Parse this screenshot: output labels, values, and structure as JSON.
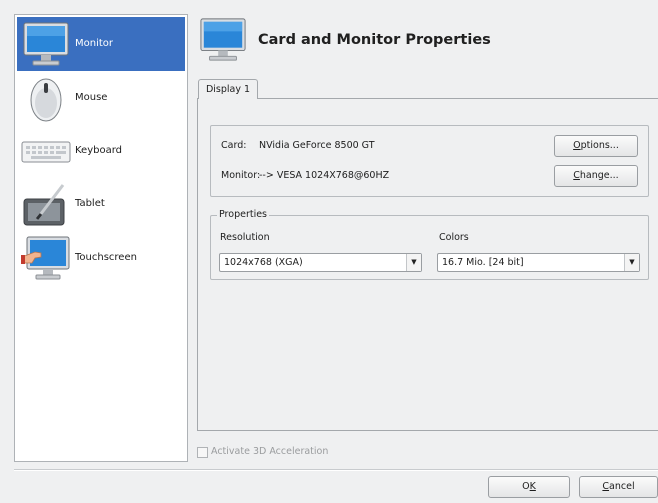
{
  "sidebar": {
    "items": [
      {
        "label": "Monitor",
        "icon": "monitor-icon",
        "selected": true
      },
      {
        "label": "Mouse",
        "icon": "mouse-icon",
        "selected": false
      },
      {
        "label": "Keyboard",
        "icon": "keyboard-icon",
        "selected": false
      },
      {
        "label": "Tablet",
        "icon": "tablet-icon",
        "selected": false
      },
      {
        "label": "Touchscreen",
        "icon": "touchscreen-icon",
        "selected": false
      }
    ]
  },
  "header": {
    "title": "Card and Monitor Properties",
    "icon": "monitor-icon"
  },
  "tabs": [
    {
      "label": "Display 1",
      "active": true
    }
  ],
  "card": {
    "card_label": "Card:",
    "card_value": "NVidia GeForce 8500 GT",
    "monitor_label": "Monitor:",
    "monitor_value": "--> VESA 1024X768@60HZ",
    "options_button": {
      "pre": "",
      "mnemonic": "O",
      "post": "ptions..."
    },
    "change_button": {
      "pre": "",
      "mnemonic": "C",
      "post": "hange..."
    }
  },
  "properties": {
    "legend": "Properties",
    "resolution_label": "Resolution",
    "resolution_value": "1024x768 (XGA)",
    "colors_label": "Colors",
    "colors_value": "16.7 Mio. [24 bit]"
  },
  "accel": {
    "label": "Activate 3D Acceleration",
    "checked": false,
    "enabled": false
  },
  "footer": {
    "ok_button": {
      "pre": "O",
      "mnemonic": "K",
      "post": ""
    },
    "cancel_button": {
      "pre": "",
      "mnemonic": "C",
      "post": "ancel"
    }
  },
  "colors": {
    "selection": "#3a6fc0",
    "window_bg": "#eff0f1"
  }
}
